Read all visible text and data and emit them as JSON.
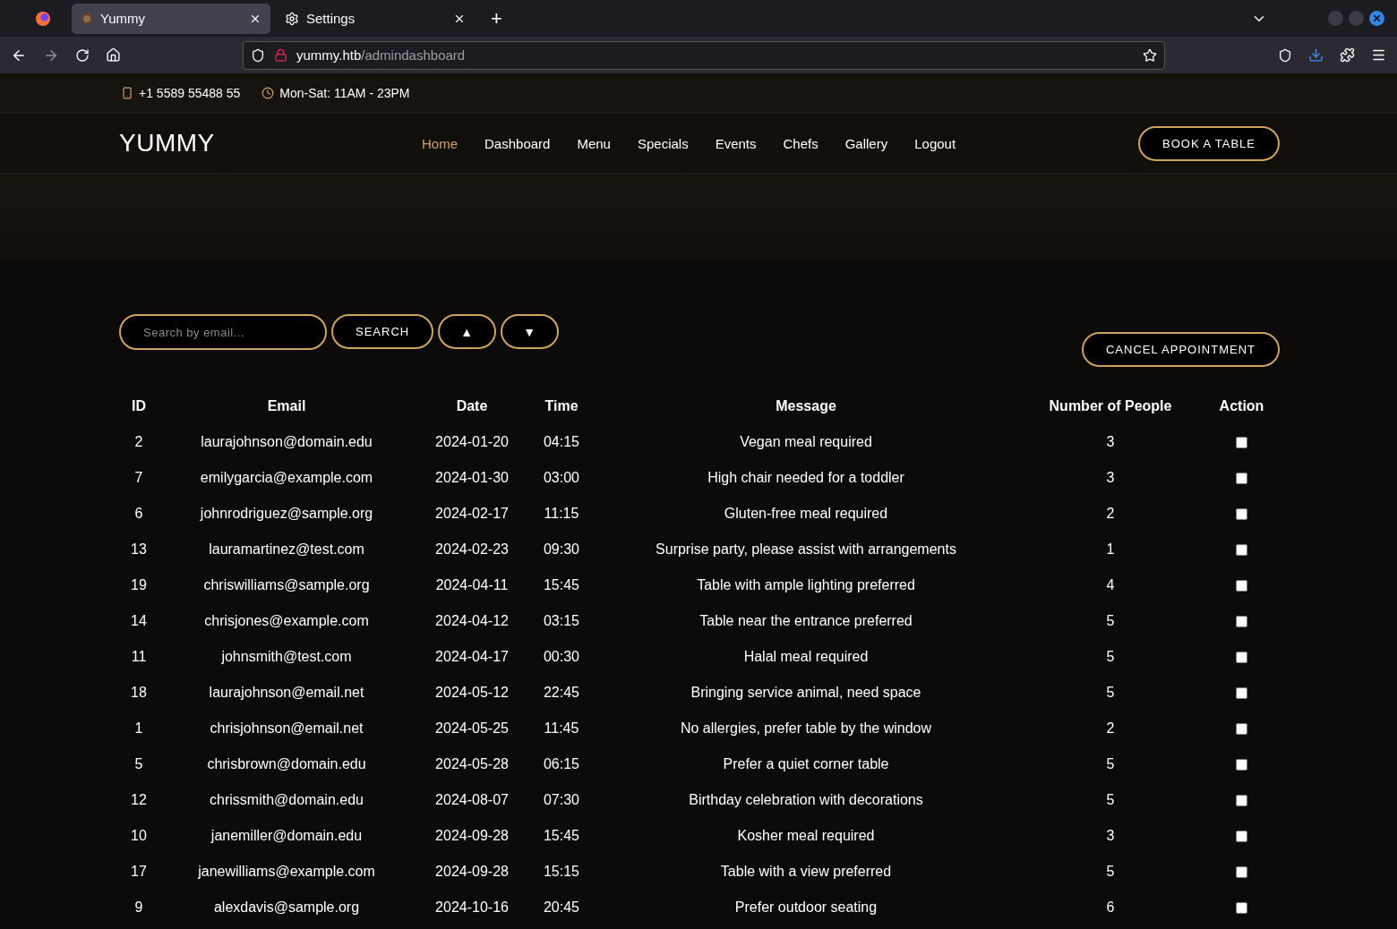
{
  "browser": {
    "tabs": [
      {
        "label": "Yummy",
        "selected": true,
        "kind": "site"
      },
      {
        "label": "Settings",
        "selected": false,
        "kind": "settings"
      }
    ],
    "new_tab": "+",
    "url": {
      "host": "yummy.htb",
      "path": "/admindashboard"
    }
  },
  "topbar": {
    "phone": "+1 5589 55488 55",
    "hours": "Mon-Sat: 11AM - 23PM"
  },
  "nav": {
    "logo": "YUMMY",
    "items": [
      {
        "label": "Home",
        "selected": true
      },
      {
        "label": "Dashboard",
        "selected": false
      },
      {
        "label": "Menu",
        "selected": false
      },
      {
        "label": "Specials",
        "selected": false
      },
      {
        "label": "Events",
        "selected": false
      },
      {
        "label": "Chefs",
        "selected": false
      },
      {
        "label": "Gallery",
        "selected": false
      },
      {
        "label": "Logout",
        "selected": false
      }
    ],
    "cta": "BOOK A TABLE"
  },
  "controls": {
    "search": {
      "placeholder": "Search by email..."
    },
    "search_button": "SEARCH",
    "sort_up": "▲",
    "sort_down": "▼",
    "cancel_button": "CANCEL APPOINTMENT"
  },
  "table": {
    "columns": [
      "ID",
      "Email",
      "Date",
      "Time",
      "Message",
      "Number of People",
      "Action"
    ],
    "rows": [
      {
        "cells": [
          "2",
          "laurajohnson@domain.edu",
          "2024-01-20",
          "04:15",
          "Vegan meal required",
          "3"
        ],
        "checked": false
      },
      {
        "cells": [
          "7",
          "emilygarcia@example.com",
          "2024-01-30",
          "03:00",
          "High chair needed for a toddler",
          "3"
        ],
        "checked": false
      },
      {
        "cells": [
          "6",
          "johnrodriguez@sample.org",
          "2024-02-17",
          "11:15",
          "Gluten-free meal required",
          "2"
        ],
        "checked": false
      },
      {
        "cells": [
          "13",
          "lauramartinez@test.com",
          "2024-02-23",
          "09:30",
          "Surprise party, please assist with arrangements",
          "1"
        ],
        "checked": false
      },
      {
        "cells": [
          "19",
          "chriswilliams@sample.org",
          "2024-04-11",
          "15:45",
          "Table with ample lighting preferred",
          "4"
        ],
        "checked": false
      },
      {
        "cells": [
          "14",
          "chrisjones@example.com",
          "2024-04-12",
          "03:15",
          "Table near the entrance preferred",
          "5"
        ],
        "checked": false
      },
      {
        "cells": [
          "11",
          "johnsmith@test.com",
          "2024-04-17",
          "00:30",
          "Halal meal required",
          "5"
        ],
        "checked": false
      },
      {
        "cells": [
          "18",
          "laurajohnson@email.net",
          "2024-05-12",
          "22:45",
          "Bringing service animal, need space",
          "5"
        ],
        "checked": false
      },
      {
        "cells": [
          "1",
          "chrisjohnson@email.net",
          "2024-05-25",
          "11:45",
          "No allergies, prefer table by the window",
          "2"
        ],
        "checked": false
      },
      {
        "cells": [
          "5",
          "chrisbrown@domain.edu",
          "2024-05-28",
          "06:15",
          "Prefer a quiet corner table",
          "5"
        ],
        "checked": false
      },
      {
        "cells": [
          "12",
          "chrissmith@domain.edu",
          "2024-08-07",
          "07:30",
          "Birthday celebration with decorations",
          "5"
        ],
        "checked": false
      },
      {
        "cells": [
          "10",
          "janemiller@domain.edu",
          "2024-09-28",
          "15:45",
          "Kosher meal required",
          "3"
        ],
        "checked": false
      },
      {
        "cells": [
          "17",
          "janewilliams@example.com",
          "2024-09-28",
          "15:15",
          "Table with a view preferred",
          "5"
        ],
        "checked": false
      },
      {
        "cells": [
          "9",
          "alexdavis@sample.org",
          "2024-10-16",
          "20:45",
          "Prefer outdoor seating",
          "6"
        ],
        "checked": false
      }
    ]
  }
}
